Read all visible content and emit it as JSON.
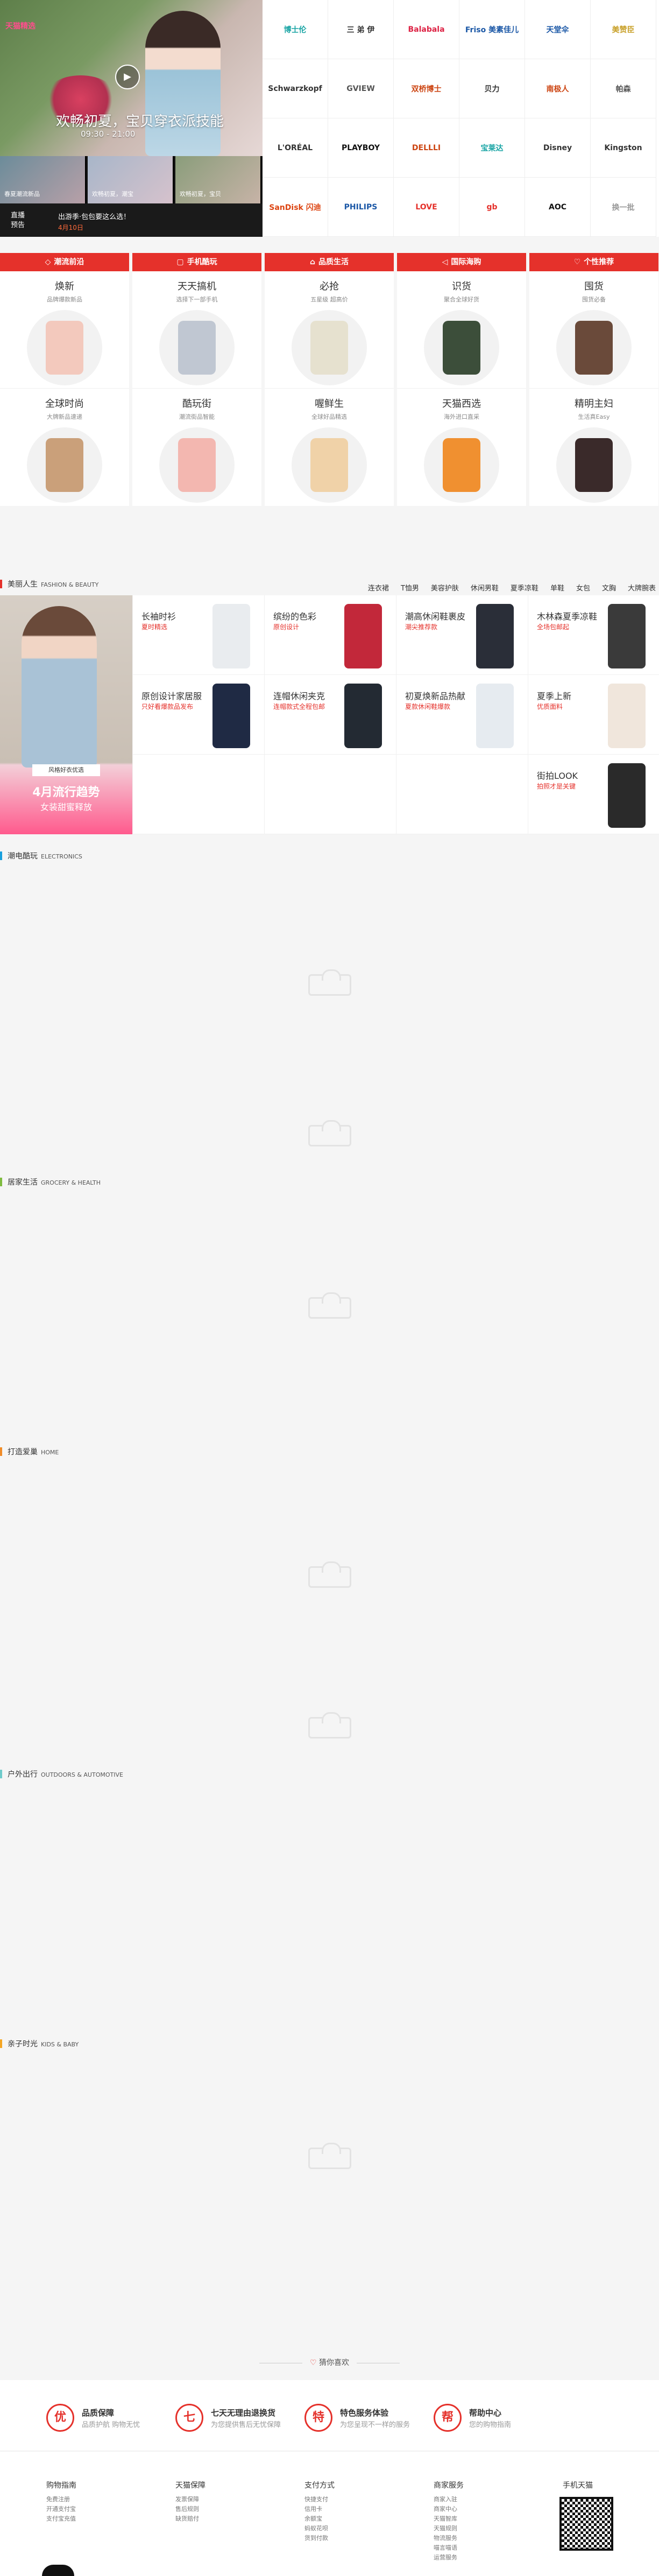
{
  "hero": {
    "logo": "天猫精选",
    "title": "欢畅初夏，宝贝穿衣派技能",
    "time": "09:30 - 21:00"
  },
  "thumbs": [
    "春夏潮流新品",
    "欢畅初夏，潮宝",
    "欢畅初夏，宝贝"
  ],
  "preview": {
    "label_line1": "直播",
    "label_line2": "预告",
    "text": "出游季·包包要这么选！",
    "date": "4月10日"
  },
  "brands": [
    "博士伦",
    "三 弟 伊",
    "Balabala",
    "Friso 美素佳儿",
    "天堂伞",
    "美赞臣",
    "Schwarzkopf",
    "GVIEW",
    "双桥博士",
    "贝力",
    "南极人",
    "帕森",
    "L'ORÉAL",
    "PLAYBOY",
    "DELLLI",
    "宝莱达",
    "Disney",
    "Kingston",
    "SanDisk 闪迪",
    "PHILIPS",
    "LOVE",
    "gb",
    "AOC",
    "换一批"
  ],
  "channels": [
    {
      "name": "潮流前沿",
      "cells": [
        {
          "t": "焕新",
          "s": "品牌爆款新品"
        },
        {
          "t": "全球时尚",
          "s": "大牌新品速递"
        }
      ]
    },
    {
      "name": "手机酷玩",
      "cells": [
        {
          "t": "天天搞机",
          "s": "选择下一部手机"
        },
        {
          "t": "酷玩街",
          "s": "潮流街品智能"
        }
      ]
    },
    {
      "name": "品质生活",
      "cells": [
        {
          "t": "必抢",
          "s": "五星级 超高价"
        },
        {
          "t": "喔鲜生",
          "s": "全球好品精选"
        }
      ]
    },
    {
      "name": "国际海购",
      "cells": [
        {
          "t": "识货",
          "s": "聚合全球好货"
        },
        {
          "t": "天猫西选",
          "s": "海外进口直采"
        }
      ]
    },
    {
      "name": "个性推荐",
      "cells": [
        {
          "t": "囤货",
          "s": "囤货必备"
        },
        {
          "t": "精明主妇",
          "s": "生活真Easy"
        }
      ]
    }
  ],
  "floors": [
    {
      "title": "美丽人生",
      "en": "FASHION & BEAUTY",
      "color": "#e5312b"
    },
    {
      "title": "潮电酷玩",
      "en": "ELECTRONICS",
      "color": "#19a0dd"
    },
    {
      "title": "居家生活",
      "en": "GROCERY & HEALTH",
      "color": "#7fbb3f"
    },
    {
      "title": "打造爱巢",
      "en": "HOME",
      "color": "#f08c28"
    },
    {
      "title": "户外出行",
      "en": "OUTDOORS & AUTOMOTIVE",
      "color": "#6fcbcb"
    },
    {
      "title": "亲子时光",
      "en": "KIDS & BABY",
      "color": "#f5a623"
    }
  ],
  "fashion": {
    "nav": [
      "连衣裙",
      "T恤男",
      "美容护肤",
      "休闲男鞋",
      "夏季凉鞋",
      "单鞋",
      "女包",
      "文胸",
      "大牌腕表"
    ],
    "banner_sub": "风格好衣优选",
    "banner_title": "4月流行趋势",
    "banner_desc": "女装甜蜜释放",
    "cells": [
      {
        "t": "长袖时衫",
        "s": "夏时精选"
      },
      {
        "t": "缤纷的色彩",
        "s": "原创设计"
      },
      {
        "t": "潮高休闲鞋裹皮",
        "s": "潮尖推荐款"
      },
      {
        "t": "木林森夏季凉鞋",
        "s": "全场包邮起"
      },
      {
        "t": "夏季上新",
        "s": "优质面料"
      },
      {
        "t": "原创设计家居服",
        "s": "只好看爆款品发布"
      },
      {
        "t": "连帽休闲夹克",
        "s": "连帽款式全程包邮"
      },
      {
        "t": "初夏焕新品热献",
        "s": "夏款休闲鞋爆款"
      },
      {
        "t": "街拍LOOK",
        "s": "拍照才是关键"
      }
    ]
  },
  "guess": "猜你喜欢",
  "guarantees": [
    {
      "icon": "优",
      "t": "品质保障",
      "s": "品质护航 购物无忧"
    },
    {
      "icon": "七",
      "t": "七天无理由退换货",
      "s": "为您提供售后无忧保障"
    },
    {
      "icon": "特",
      "t": "特色服务体验",
      "s": "为您呈现不一样的服务"
    },
    {
      "icon": "帮",
      "t": "帮助中心",
      "s": "您的购物指南"
    }
  ],
  "footer_cols": [
    {
      "h": "购物指南",
      "items": [
        "免费注册",
        "开通支付宝",
        "支付宝充值"
      ]
    },
    {
      "h": "天猫保障",
      "items": [
        "发票保障",
        "售后规则",
        "缺货赔付"
      ]
    },
    {
      "h": "支付方式",
      "items": [
        "快捷支付",
        "信用卡",
        "余额宝",
        "蚂蚁花呗",
        "货到付款"
      ]
    },
    {
      "h": "商家服务",
      "items": [
        "商家入驻",
        "商家中心",
        "天猫智库",
        "天猫规则",
        "物流服务",
        "喵言喵语",
        "运营服务"
      ]
    },
    {
      "h": "手机天猫",
      "items": []
    }
  ]
}
